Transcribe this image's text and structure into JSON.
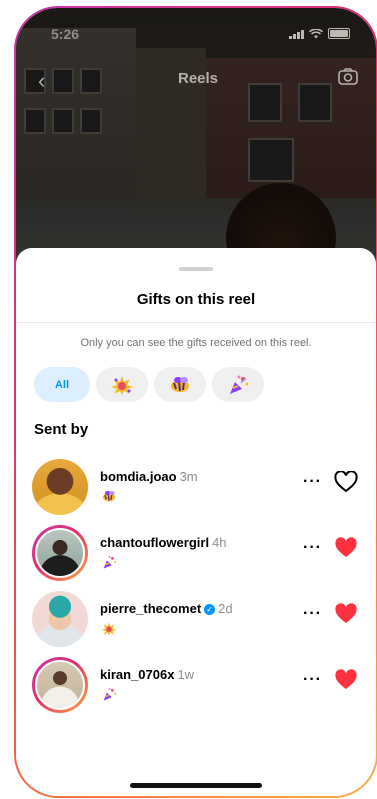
{
  "status_bar": {
    "time": "5:26"
  },
  "top_bar": {
    "back_glyph": "‹",
    "title": "Reels",
    "camera_icon": "camera-icon"
  },
  "sheet": {
    "title": "Gifts on this reel",
    "subtitle": "Only you can see the gifts received on this reel.",
    "filters": [
      {
        "label": "All",
        "active": true
      },
      {
        "icon": "gift-burst-icon",
        "active": false
      },
      {
        "icon": "gift-star-bee-icon",
        "active": false
      },
      {
        "icon": "gift-party-popper-icon",
        "active": false
      }
    ],
    "section_title": "Sent by",
    "senders": [
      {
        "username": "bomdia.joao",
        "time": "3m",
        "verified": false,
        "liked": false,
        "gift": "gift-star-bee-icon"
      },
      {
        "username": "chantouflowergirl",
        "time": "4h",
        "verified": false,
        "liked": true,
        "gift": "gift-party-popper-icon"
      },
      {
        "username": "pierre_thecomet",
        "time": "2d",
        "verified": true,
        "liked": true,
        "gift": "gift-burst-icon"
      },
      {
        "username": "kiran_0706x",
        "time": "1w",
        "verified": false,
        "liked": true,
        "gift": "gift-party-popper-icon"
      }
    ]
  },
  "colors": {
    "accent_blue": "#0095f6",
    "heart_red": "#ff3040",
    "chip_active_bg": "#ddeefe"
  }
}
